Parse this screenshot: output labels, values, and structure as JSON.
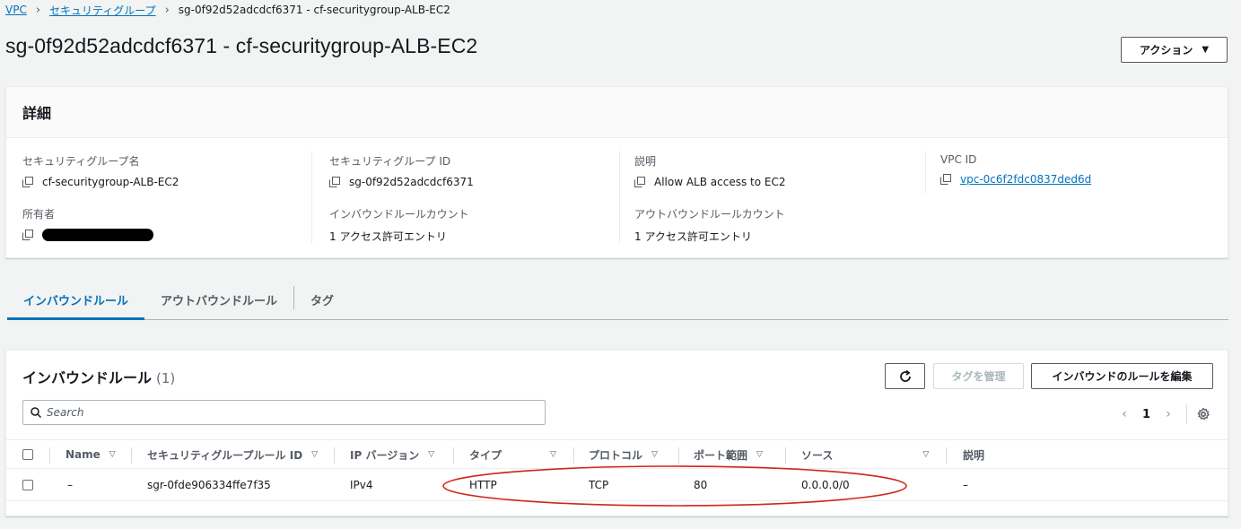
{
  "breadcrumb": {
    "items": [
      "VPC",
      "セキュリティグループ"
    ],
    "current": "sg-0f92d52adcdcf6371 - cf-securitygroup-ALB-EC2"
  },
  "page": {
    "title": "sg-0f92d52adcdcf6371 - cf-securitygroup-ALB-EC2",
    "actions_label": "アクション"
  },
  "details": {
    "header": "詳細",
    "sg_name_label": "セキュリティグループ名",
    "sg_name": "cf-securitygroup-ALB-EC2",
    "sg_id_label": "セキュリティグループ ID",
    "sg_id": "sg-0f92d52adcdcf6371",
    "description_label": "説明",
    "description": "Allow ALB access to EC2",
    "vpc_id_label": "VPC ID",
    "vpc_id": "vpc-0c6f2fdc0837ded6d",
    "owner_label": "所有者",
    "inbound_count_label": "インバウンドルールカウント",
    "inbound_count": "1 アクセス許可エントリ",
    "outbound_count_label": "アウトバウンドルールカウント",
    "outbound_count": "1 アクセス許可エントリ"
  },
  "tabs": [
    "インバウンドルール",
    "アウトバウンドルール",
    "タグ"
  ],
  "inbound": {
    "title": "インバウンドルール",
    "count": "(1)",
    "tag_manage_label": "タグを管理",
    "edit_label": "インバウンドのルールを編集",
    "search_placeholder": "Search",
    "page": "1",
    "columns": [
      "Name",
      "セキュリティグループルール ID",
      "IP バージョン",
      "タイプ",
      "プロトコル",
      "ポート範囲",
      "ソース",
      "説明"
    ],
    "rows": [
      {
        "name": "–",
        "rule_id": "sgr-0fde906334ffe7f35",
        "ip_version": "IPv4",
        "type": "HTTP",
        "protocol": "TCP",
        "port_range": "80",
        "source": "0.0.0.0/0",
        "description": "–"
      }
    ]
  },
  "colors": {
    "link": "#0073bb",
    "annotation": "#d0251b"
  }
}
